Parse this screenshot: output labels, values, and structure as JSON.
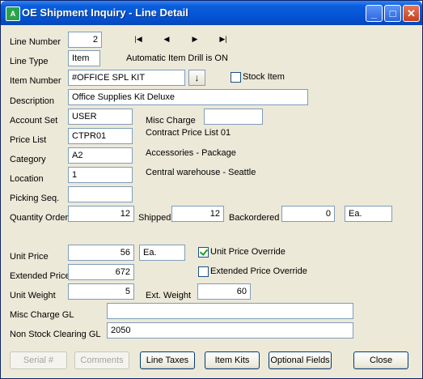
{
  "window": {
    "title": "OE Shipment Inquiry - Line Detail",
    "icon_name": "accpac-app-icon"
  },
  "titlebar_buttons": {
    "minimize": "_",
    "maximize": "□",
    "close": "✕"
  },
  "line_number": {
    "label": "Line Number",
    "value": "2"
  },
  "nav": {
    "first": "|◀",
    "prev": "◀",
    "next": "▶",
    "last": "▶|"
  },
  "line_type": {
    "label": "Line Type",
    "value": "Item"
  },
  "drill_message": "Automatic Item Drill is ON",
  "item_number": {
    "label": "Item Number",
    "value": "#OFFICE SPL KIT",
    "finder_icon": "↓"
  },
  "stock_item": {
    "label": "Stock Item",
    "checked": false
  },
  "description": {
    "label": "Description",
    "value": "Office Supplies Kit Deluxe"
  },
  "account_set": {
    "label": "Account Set",
    "value": "USER"
  },
  "misc_charge": {
    "label": "Misc Charge",
    "value": ""
  },
  "price_list": {
    "label": "Price List",
    "value": "CTPR01",
    "description": "Contract Price List 01"
  },
  "category": {
    "label": "Category",
    "value": "A2",
    "description": "Accessories - Package"
  },
  "location": {
    "label": "Location",
    "value": "1",
    "description": "Central warehouse - Seattle"
  },
  "picking_seq": {
    "label": "Picking Seq.",
    "value": ""
  },
  "quantity_order": {
    "label": "Quantity Order",
    "value": "12"
  },
  "shipped": {
    "label": "Shipped",
    "value": "12"
  },
  "backordered": {
    "label": "Backordered",
    "value": "0"
  },
  "uom": {
    "value": "Ea."
  },
  "unit_price": {
    "label": "Unit Price",
    "value": "56",
    "uom": "Ea."
  },
  "unit_price_override": {
    "label": "Unit Price Override",
    "checked": true
  },
  "extended_price": {
    "label": "Extended Price",
    "value": "672"
  },
  "extended_price_override": {
    "label": "Extended Price Override",
    "checked": false
  },
  "unit_weight": {
    "label": "Unit Weight",
    "value": "5"
  },
  "ext_weight": {
    "label": "Ext. Weight",
    "value": "60"
  },
  "misc_charge_gl": {
    "label": "Misc Charge GL",
    "value": ""
  },
  "non_stock_clearing_gl": {
    "label": "Non Stock Clearing GL",
    "value": "2050"
  },
  "buttons": {
    "serial": "Serial #",
    "comments": "Comments",
    "line_taxes": "Line Taxes",
    "item_kits": "Item Kits",
    "optional_fields": "Optional Fields",
    "close": "Close"
  }
}
